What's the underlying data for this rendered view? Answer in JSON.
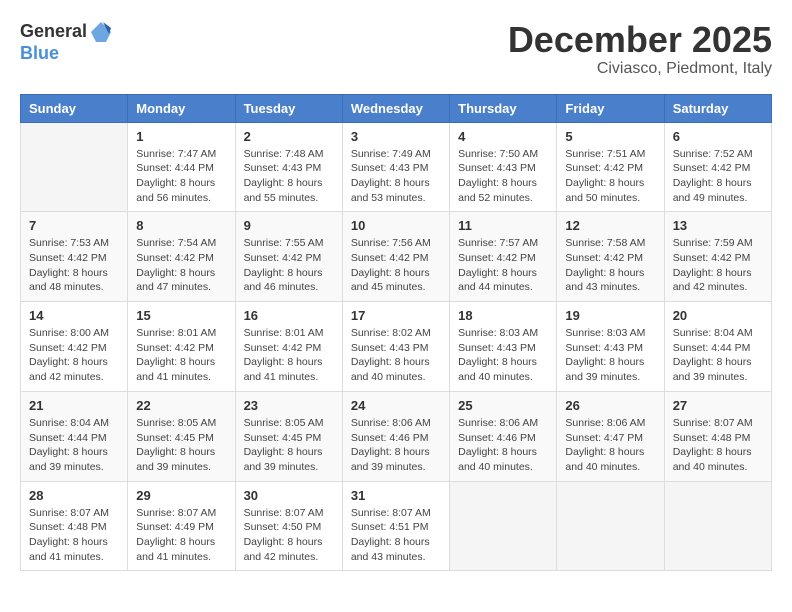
{
  "header": {
    "logo_general": "General",
    "logo_blue": "Blue",
    "month": "December 2025",
    "location": "Civiasco, Piedmont, Italy"
  },
  "days_of_week": [
    "Sunday",
    "Monday",
    "Tuesday",
    "Wednesday",
    "Thursday",
    "Friday",
    "Saturday"
  ],
  "weeks": [
    [
      {
        "day": "",
        "sunrise": "",
        "sunset": "",
        "daylight": ""
      },
      {
        "day": "1",
        "sunrise": "Sunrise: 7:47 AM",
        "sunset": "Sunset: 4:44 PM",
        "daylight": "Daylight: 8 hours and 56 minutes."
      },
      {
        "day": "2",
        "sunrise": "Sunrise: 7:48 AM",
        "sunset": "Sunset: 4:43 PM",
        "daylight": "Daylight: 8 hours and 55 minutes."
      },
      {
        "day": "3",
        "sunrise": "Sunrise: 7:49 AM",
        "sunset": "Sunset: 4:43 PM",
        "daylight": "Daylight: 8 hours and 53 minutes."
      },
      {
        "day": "4",
        "sunrise": "Sunrise: 7:50 AM",
        "sunset": "Sunset: 4:43 PM",
        "daylight": "Daylight: 8 hours and 52 minutes."
      },
      {
        "day": "5",
        "sunrise": "Sunrise: 7:51 AM",
        "sunset": "Sunset: 4:42 PM",
        "daylight": "Daylight: 8 hours and 50 minutes."
      },
      {
        "day": "6",
        "sunrise": "Sunrise: 7:52 AM",
        "sunset": "Sunset: 4:42 PM",
        "daylight": "Daylight: 8 hours and 49 minutes."
      }
    ],
    [
      {
        "day": "7",
        "sunrise": "Sunrise: 7:53 AM",
        "sunset": "Sunset: 4:42 PM",
        "daylight": "Daylight: 8 hours and 48 minutes."
      },
      {
        "day": "8",
        "sunrise": "Sunrise: 7:54 AM",
        "sunset": "Sunset: 4:42 PM",
        "daylight": "Daylight: 8 hours and 47 minutes."
      },
      {
        "day": "9",
        "sunrise": "Sunrise: 7:55 AM",
        "sunset": "Sunset: 4:42 PM",
        "daylight": "Daylight: 8 hours and 46 minutes."
      },
      {
        "day": "10",
        "sunrise": "Sunrise: 7:56 AM",
        "sunset": "Sunset: 4:42 PM",
        "daylight": "Daylight: 8 hours and 45 minutes."
      },
      {
        "day": "11",
        "sunrise": "Sunrise: 7:57 AM",
        "sunset": "Sunset: 4:42 PM",
        "daylight": "Daylight: 8 hours and 44 minutes."
      },
      {
        "day": "12",
        "sunrise": "Sunrise: 7:58 AM",
        "sunset": "Sunset: 4:42 PM",
        "daylight": "Daylight: 8 hours and 43 minutes."
      },
      {
        "day": "13",
        "sunrise": "Sunrise: 7:59 AM",
        "sunset": "Sunset: 4:42 PM",
        "daylight": "Daylight: 8 hours and 42 minutes."
      }
    ],
    [
      {
        "day": "14",
        "sunrise": "Sunrise: 8:00 AM",
        "sunset": "Sunset: 4:42 PM",
        "daylight": "Daylight: 8 hours and 42 minutes."
      },
      {
        "day": "15",
        "sunrise": "Sunrise: 8:01 AM",
        "sunset": "Sunset: 4:42 PM",
        "daylight": "Daylight: 8 hours and 41 minutes."
      },
      {
        "day": "16",
        "sunrise": "Sunrise: 8:01 AM",
        "sunset": "Sunset: 4:42 PM",
        "daylight": "Daylight: 8 hours and 41 minutes."
      },
      {
        "day": "17",
        "sunrise": "Sunrise: 8:02 AM",
        "sunset": "Sunset: 4:43 PM",
        "daylight": "Daylight: 8 hours and 40 minutes."
      },
      {
        "day": "18",
        "sunrise": "Sunrise: 8:03 AM",
        "sunset": "Sunset: 4:43 PM",
        "daylight": "Daylight: 8 hours and 40 minutes."
      },
      {
        "day": "19",
        "sunrise": "Sunrise: 8:03 AM",
        "sunset": "Sunset: 4:43 PM",
        "daylight": "Daylight: 8 hours and 39 minutes."
      },
      {
        "day": "20",
        "sunrise": "Sunrise: 8:04 AM",
        "sunset": "Sunset: 4:44 PM",
        "daylight": "Daylight: 8 hours and 39 minutes."
      }
    ],
    [
      {
        "day": "21",
        "sunrise": "Sunrise: 8:04 AM",
        "sunset": "Sunset: 4:44 PM",
        "daylight": "Daylight: 8 hours and 39 minutes."
      },
      {
        "day": "22",
        "sunrise": "Sunrise: 8:05 AM",
        "sunset": "Sunset: 4:45 PM",
        "daylight": "Daylight: 8 hours and 39 minutes."
      },
      {
        "day": "23",
        "sunrise": "Sunrise: 8:05 AM",
        "sunset": "Sunset: 4:45 PM",
        "daylight": "Daylight: 8 hours and 39 minutes."
      },
      {
        "day": "24",
        "sunrise": "Sunrise: 8:06 AM",
        "sunset": "Sunset: 4:46 PM",
        "daylight": "Daylight: 8 hours and 39 minutes."
      },
      {
        "day": "25",
        "sunrise": "Sunrise: 8:06 AM",
        "sunset": "Sunset: 4:46 PM",
        "daylight": "Daylight: 8 hours and 40 minutes."
      },
      {
        "day": "26",
        "sunrise": "Sunrise: 8:06 AM",
        "sunset": "Sunset: 4:47 PM",
        "daylight": "Daylight: 8 hours and 40 minutes."
      },
      {
        "day": "27",
        "sunrise": "Sunrise: 8:07 AM",
        "sunset": "Sunset: 4:48 PM",
        "daylight": "Daylight: 8 hours and 40 minutes."
      }
    ],
    [
      {
        "day": "28",
        "sunrise": "Sunrise: 8:07 AM",
        "sunset": "Sunset: 4:48 PM",
        "daylight": "Daylight: 8 hours and 41 minutes."
      },
      {
        "day": "29",
        "sunrise": "Sunrise: 8:07 AM",
        "sunset": "Sunset: 4:49 PM",
        "daylight": "Daylight: 8 hours and 41 minutes."
      },
      {
        "day": "30",
        "sunrise": "Sunrise: 8:07 AM",
        "sunset": "Sunset: 4:50 PM",
        "daylight": "Daylight: 8 hours and 42 minutes."
      },
      {
        "day": "31",
        "sunrise": "Sunrise: 8:07 AM",
        "sunset": "Sunset: 4:51 PM",
        "daylight": "Daylight: 8 hours and 43 minutes."
      },
      {
        "day": "",
        "sunrise": "",
        "sunset": "",
        "daylight": ""
      },
      {
        "day": "",
        "sunrise": "",
        "sunset": "",
        "daylight": ""
      },
      {
        "day": "",
        "sunrise": "",
        "sunset": "",
        "daylight": ""
      }
    ]
  ]
}
